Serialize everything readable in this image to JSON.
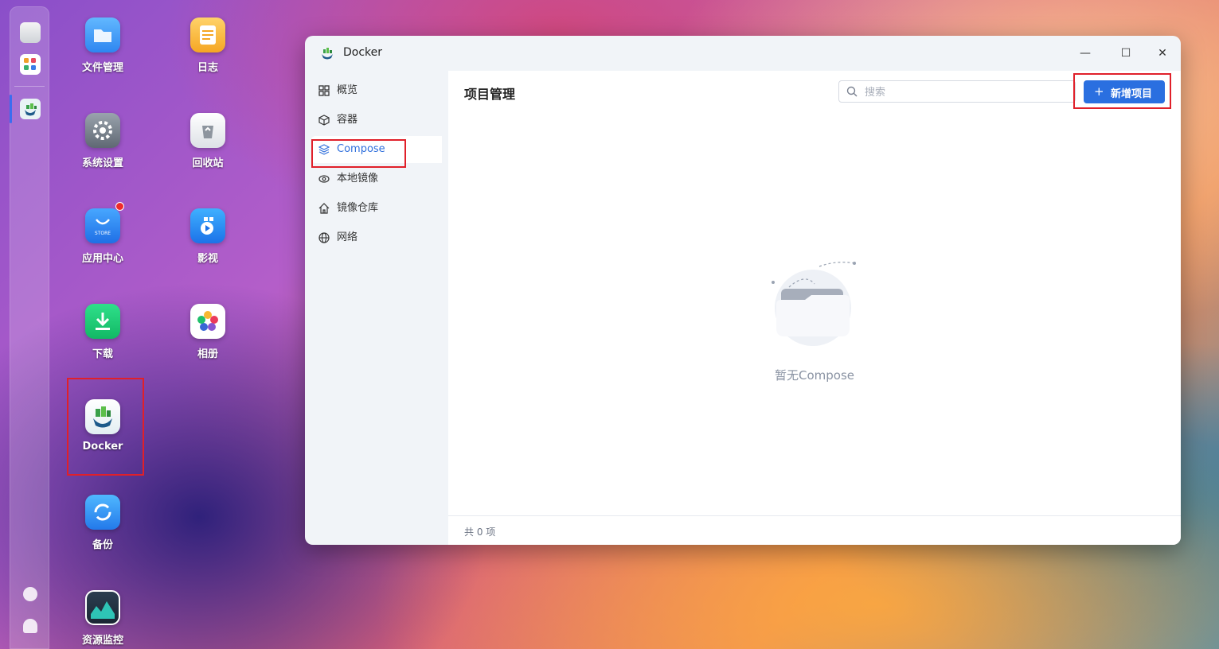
{
  "desktop": {
    "icons": [
      {
        "label": "文件管理"
      },
      {
        "label": "日志"
      },
      {
        "label": "系统设置"
      },
      {
        "label": "回收站"
      },
      {
        "label": "应用中心",
        "tile_text": "STORE"
      },
      {
        "label": "影视"
      },
      {
        "label": "下载"
      },
      {
        "label": "相册"
      },
      {
        "label": "Docker"
      },
      {
        "label": "备份"
      },
      {
        "label": "资源监控"
      }
    ]
  },
  "window": {
    "title": "Docker",
    "controls": {
      "minimize": "—",
      "maximize": "☐",
      "close": "✕"
    },
    "sidebar": {
      "items": [
        {
          "label": "概览",
          "icon": "grid-icon"
        },
        {
          "label": "容器",
          "icon": "cube-icon"
        },
        {
          "label": "Compose",
          "icon": "layers-icon",
          "active": true
        },
        {
          "label": "本地镜像",
          "icon": "eye-icon"
        },
        {
          "label": "镜像仓库",
          "icon": "home-icon"
        },
        {
          "label": "网络",
          "icon": "globe-icon"
        }
      ]
    },
    "main": {
      "title": "项目管理",
      "search_placeholder": "搜索",
      "new_button": {
        "icon": "+",
        "label": "新增项目"
      },
      "empty_text": "暂无Compose",
      "footer_count": "共 0 项"
    }
  },
  "colors": {
    "accent": "#2a6fe0",
    "highlight": "#e0202a",
    "active_text": "#2f6fdc"
  }
}
